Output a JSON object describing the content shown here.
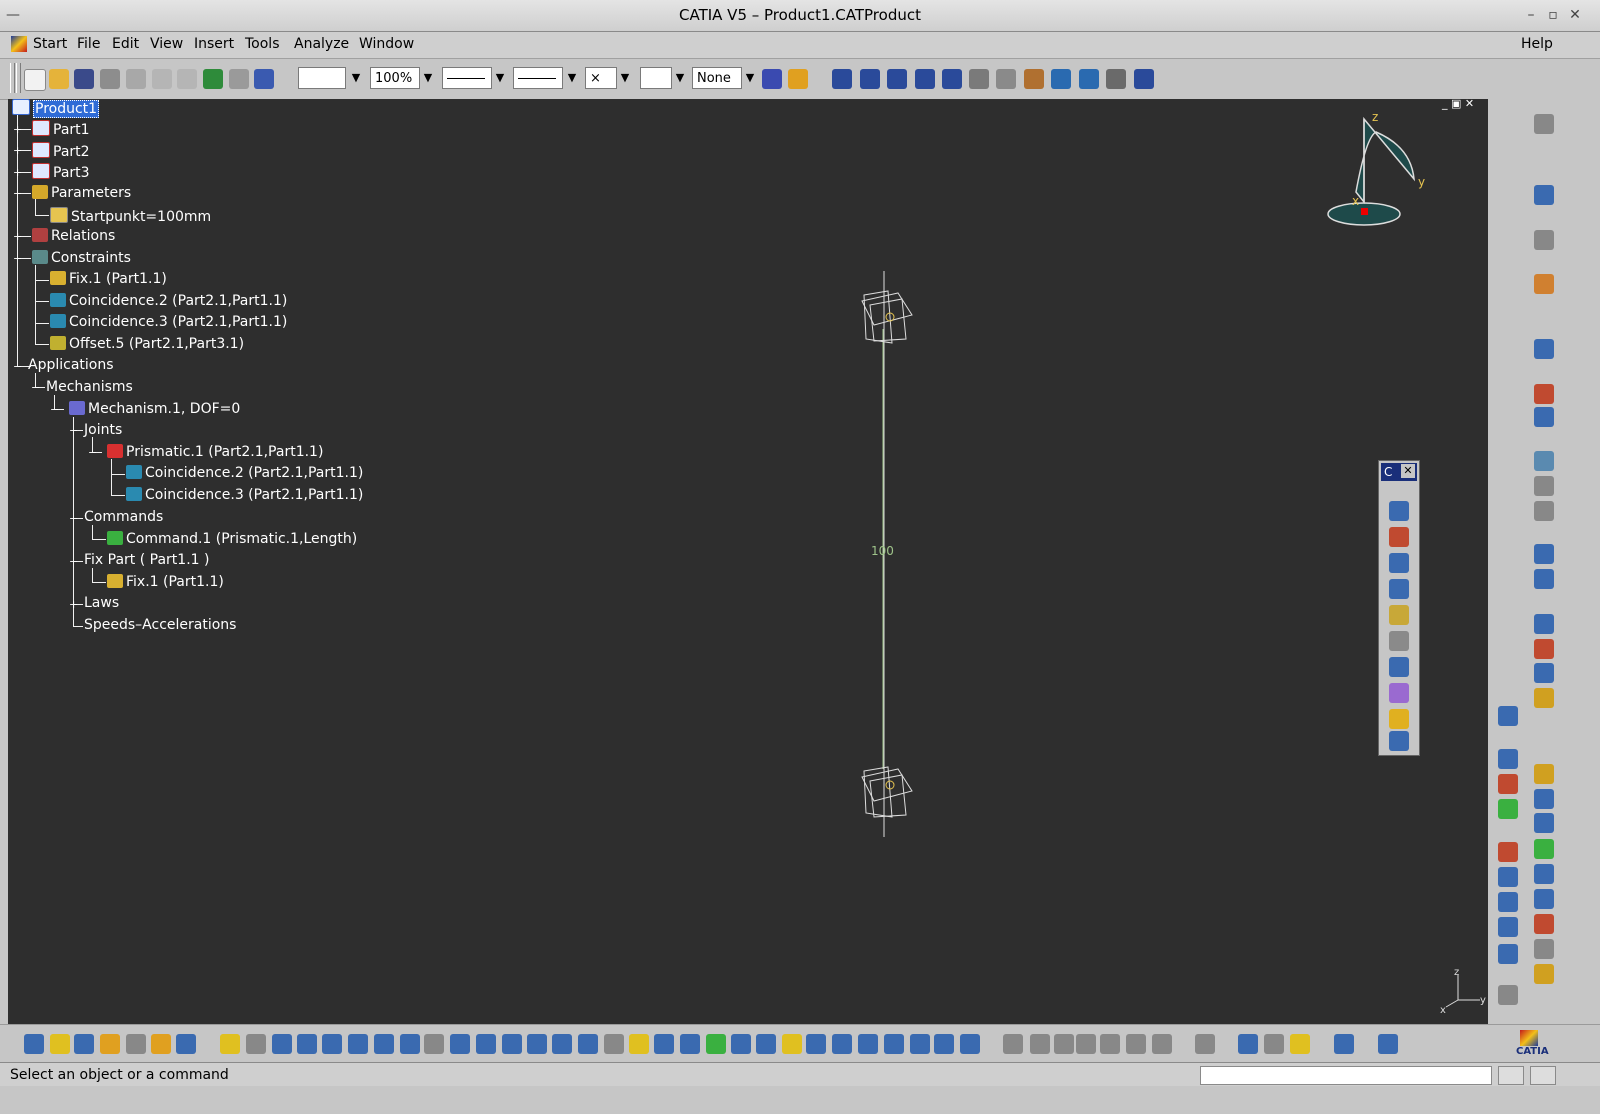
{
  "window": {
    "title": "CATIA V5 – Product1.CATProduct"
  },
  "menu": {
    "items": [
      "Start",
      "File",
      "Edit",
      "View",
      "Insert",
      "Tools",
      "Analyze",
      "Window"
    ],
    "help": "Help"
  },
  "toolbar": {
    "zoom": "100%",
    "point_style": "×",
    "layer": "None"
  },
  "tree": {
    "root": "Product1",
    "items": [
      {
        "label": "Part1",
        "level": 1
      },
      {
        "label": "Part2",
        "level": 1
      },
      {
        "label": "Part3",
        "level": 1
      },
      {
        "label": "Parameters",
        "level": 1
      },
      {
        "label": "Startpunkt=100mm",
        "level": 2
      },
      {
        "label": "Relations",
        "level": 1
      },
      {
        "label": "Constraints",
        "level": 1
      },
      {
        "label": "Fix.1 (Part1.1)",
        "level": 2
      },
      {
        "label": "Coincidence.2 (Part2.1,Part1.1)",
        "level": 2
      },
      {
        "label": "Coincidence.3 (Part2.1,Part1.1)",
        "level": 2
      },
      {
        "label": "Offset.5 (Part2.1,Part3.1)",
        "level": 2
      },
      {
        "label": "Applications",
        "level": 0
      },
      {
        "label": "Mechanisms",
        "level": 1
      },
      {
        "label": "Mechanism.1, DOF=0",
        "level": 2
      },
      {
        "label": "Joints",
        "level": 3
      },
      {
        "label": "Prismatic.1 (Part2.1,Part1.1)",
        "level": 4
      },
      {
        "label": "Coincidence.2 (Part2.1,Part1.1)",
        "level": 5
      },
      {
        "label": "Coincidence.3 (Part2.1,Part1.1)",
        "level": 5
      },
      {
        "label": "Commands",
        "level": 3
      },
      {
        "label": "Command.1 (Prismatic.1,Length)",
        "level": 4
      },
      {
        "label": "Fix Part ( Part1.1 )",
        "level": 3
      },
      {
        "label": "Fix.1 (Part1.1)",
        "level": 4
      },
      {
        "label": "Laws",
        "level": 3
      },
      {
        "label": "Speeds–Accelerations",
        "level": 3
      }
    ]
  },
  "viewport": {
    "dimension": "100",
    "compass": {
      "x": "x",
      "y": "y",
      "z": "z"
    },
    "axis": {
      "x": "x",
      "y": "y",
      "z": "z"
    }
  },
  "palette": {
    "title": "C"
  },
  "status": {
    "message": "Select an object or a command"
  },
  "colors": {
    "viewport_bg": "#2e2e2e",
    "selection": "#2f6bd6",
    "geometry": "#9fc48a",
    "tree_text": "#ffffff"
  }
}
